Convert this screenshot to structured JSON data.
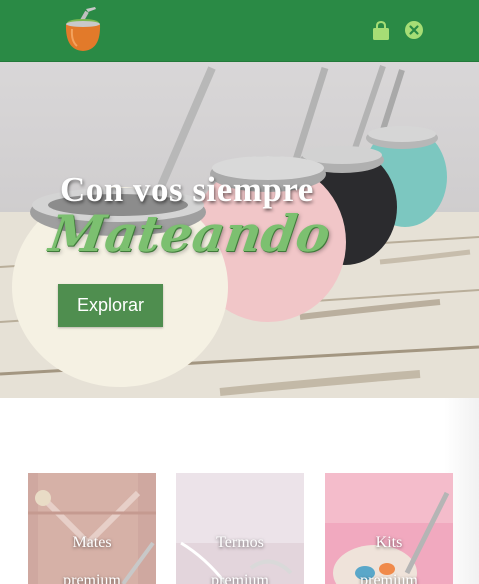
{
  "header": {
    "logo_icon": "mate-gourd-logo-icon",
    "cart_icon": "shopping-bag-icon",
    "close_icon": "close-circle-icon",
    "bg_color": "#2a8a45"
  },
  "hero": {
    "title": "Con vos siempre",
    "script": "Mateando",
    "button_label": "Explorar",
    "script_color": "#7cc070",
    "button_color": "#4f8e4f"
  },
  "categories": [
    {
      "line1": "Mates",
      "line2": "premium"
    },
    {
      "line1": "Termos",
      "line2": "premium"
    },
    {
      "line1": "Kits",
      "line2": "premium"
    }
  ]
}
